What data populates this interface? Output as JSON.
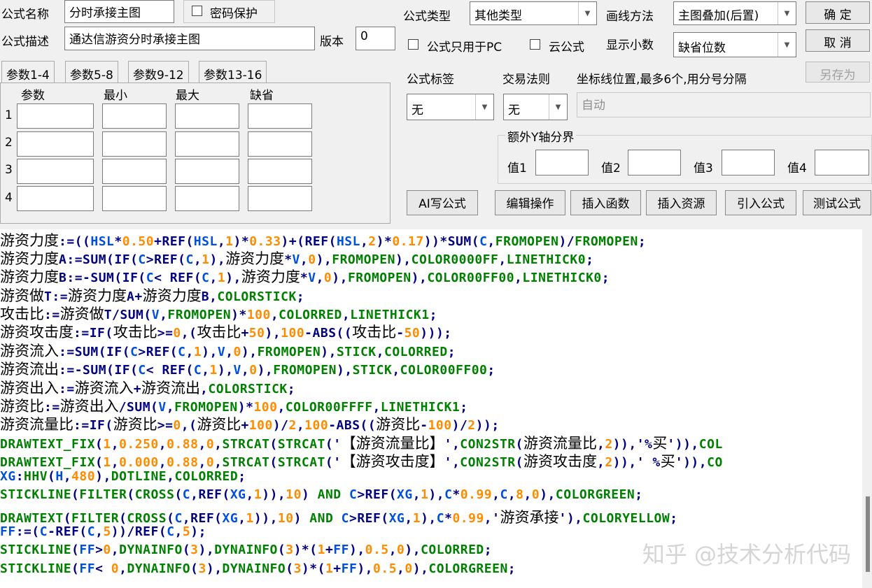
{
  "header": {
    "name_label": "公式名称",
    "name_value": "分时承接主图",
    "password_label": "密码保护",
    "desc_label": "公式描述",
    "desc_value": "通达信游资分时承接主图",
    "version_label": "版本",
    "version_value": "0",
    "type_label": "公式类型",
    "type_value": "其他类型",
    "draw_label": "画线方法",
    "draw_value": "主图叠加(后置)",
    "pc_only_label": "公式只用于PC",
    "cloud_label": "云公式",
    "decimal_label": "显示小数",
    "decimal_value": "缺省位数",
    "tag_label": "公式标签",
    "trade_label": "交易法则",
    "axis_label": "坐标线位置,最多6个,用分号分隔",
    "tag_value": "无",
    "trade_value": "无",
    "axis_value": "自动",
    "y_group_label": "额外Y轴分界",
    "y_values": [
      "值1",
      "值2",
      "值3",
      "值4"
    ]
  },
  "buttons": {
    "ok": "确  定",
    "cancel": "取  消",
    "save_as": "另存为",
    "ai": "AI写公式",
    "edit": "编辑操作",
    "insert_func": "插入函数",
    "insert_res": "插入资源",
    "import": "引入公式",
    "test": "测试公式"
  },
  "params": {
    "tabs": [
      "参数1-4",
      "参数5-8",
      "参数9-12",
      "参数13-16"
    ],
    "headers": [
      "参数",
      "最小",
      "最大",
      "缺省"
    ],
    "rows": [
      "1",
      "2",
      "3",
      "4"
    ]
  },
  "code_lines": [
    "游资力度:=((HSL*0.50+REF(HSL,1)*0.33)+(REF(HSL,2)*0.17))*SUM(C,FROMOPEN)/FROMOPEN;",
    "游资力度A:=SUM(IF(C>REF(C,1),游资力度*V,0),FROMOPEN),COLOR0000FF,LINETHICK0;",
    "游资力度B:=-SUM(IF(C< REF(C,1),游资力度*V,0),FROMOPEN),COLOR00FF00,LINETHICK0;",
    "游资做T:=游资力度A+游资力度B,COLORSTICK;",
    "攻击比:=游资做T/SUM(V,FROMOPEN)*100,COLORRED,LINETHICK1;",
    "游资攻击度:=IF(攻击比>=0,(攻击比+50),100-ABS((攻击比-50)));",
    "游资流入:=SUM(IF(C>REF(C,1),V,0),FROMOPEN),STICK,COLORRED;",
    "游资流出:=-SUM(IF(C< REF(C,1),V,0),FROMOPEN),STICK,COLOR00FF00;",
    "游资出入:=游资流入+游资流出,COLORSTICK;",
    "游资比:=游资出入/SUM(V,FROMOPEN)*100,COLOR00FFFF,LINETHICK1;",
    "游资流量比:=IF(游资比>=0,(游资比+100)/2,100-ABS((游资比-100)/2));",
    "DRAWTEXT_FIX(1,0.250,0.88,0,STRCAT(STRCAT('【游资流量比】',CON2STR(游资流量比,2)),'%买')),COL",
    "DRAWTEXT_FIX(1,0.000,0.88,0,STRCAT(STRCAT('【游资攻击度】',CON2STR(游资攻击度,2)),' %买')),CO",
    "XG:HHV(H,480),DOTLINE,COLORRED;",
    "STICKLINE(FILTER(CROSS(C,REF(XG,1)),10) AND C>REF(XG,1),C*0.99,C,8,0),COLORGREEN;",
    "DRAWTEXT(FILTER(CROSS(C,REF(XG,1)),10) AND C>REF(XG,1),C*0.99,'游资承接'),COLORYELLOW;",
    "FF:=(C-REF(C,5))/REF(C,5);",
    "STICKLINE(FF>0,DYNAINFO(3),DYNAINFO(3)*(1+FF),0.5,0),COLORRED;",
    "STICKLINE(FF< 0,DYNAINFO(3),DYNAINFO(3)*(1+FF),0.5,0),COLORGREEN;"
  ],
  "watermark": "知乎 @技术分析代码",
  "colors": {
    "function": "#000080",
    "keyword": "#008000",
    "number": "#ff8c00",
    "variable": "#0050e0",
    "background": "#f0f0f0"
  }
}
